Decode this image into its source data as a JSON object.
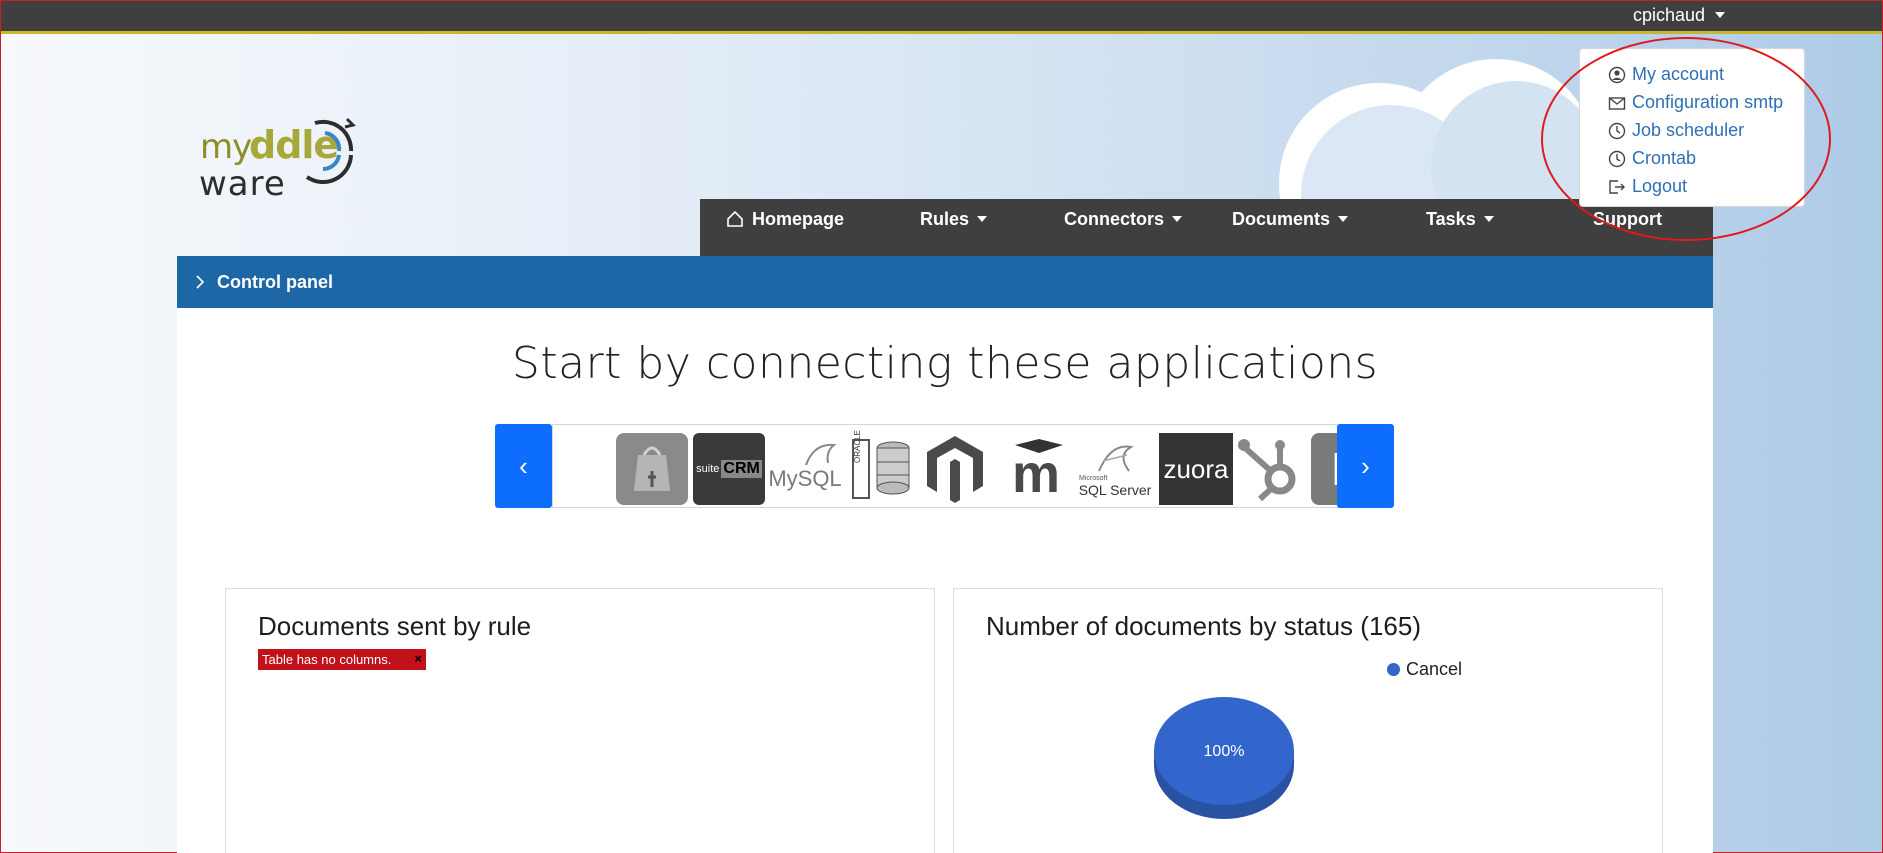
{
  "user": {
    "name": "cpichaud"
  },
  "user_dropdown": {
    "items": [
      {
        "label": "My account",
        "icon": "person-circle-icon"
      },
      {
        "label": "Configuration smtp",
        "icon": "envelope-icon"
      },
      {
        "label": "Job scheduler",
        "icon": "clock-icon"
      },
      {
        "label": "Crontab",
        "icon": "clock-icon"
      },
      {
        "label": "Logout",
        "icon": "logout-icon"
      }
    ]
  },
  "logo": {
    "part1": "my",
    "part2": "ddle",
    "part3": "ware"
  },
  "nav": {
    "items": [
      {
        "label": "Homepage"
      },
      {
        "label": "Rules"
      },
      {
        "label": "Connectors"
      },
      {
        "label": "Documents"
      },
      {
        "label": "Tasks"
      },
      {
        "label": "Support"
      }
    ]
  },
  "breadcrumb": {
    "label": "Control panel"
  },
  "main": {
    "headline": "Start by connecting these applications",
    "carousel": {
      "prev_label": "‹",
      "next_label": "›",
      "apps": [
        "Shopping",
        "suiteCRM",
        "MySQL",
        "Oracle",
        "Magento",
        "Moodle",
        "SQL Server",
        "zuora",
        "HubSpot",
        "Eventbrite"
      ],
      "app_texts": {
        "suitecrm_1": "suite",
        "suitecrm_2": "CRM",
        "mysql": "MySQL",
        "oracle": "ORACLE",
        "moodle": "m",
        "sqlserver_small": "Microsoft",
        "sqlserver": "SQL Server",
        "zuora": "zuora",
        "eventbrite": "E"
      }
    }
  },
  "cards": {
    "rule": {
      "title": "Documents sent by rule",
      "error": "Table has no columns.",
      "error_close": "×"
    },
    "status": {
      "title": "Number of documents by status (165)"
    }
  },
  "chart_data": {
    "type": "pie",
    "title": "Number of documents by status (165)",
    "categories": [
      "Cancel"
    ],
    "values": [
      100
    ],
    "labels": [
      "100%"
    ],
    "colors": [
      "#3366cc"
    ],
    "legend": "right"
  }
}
